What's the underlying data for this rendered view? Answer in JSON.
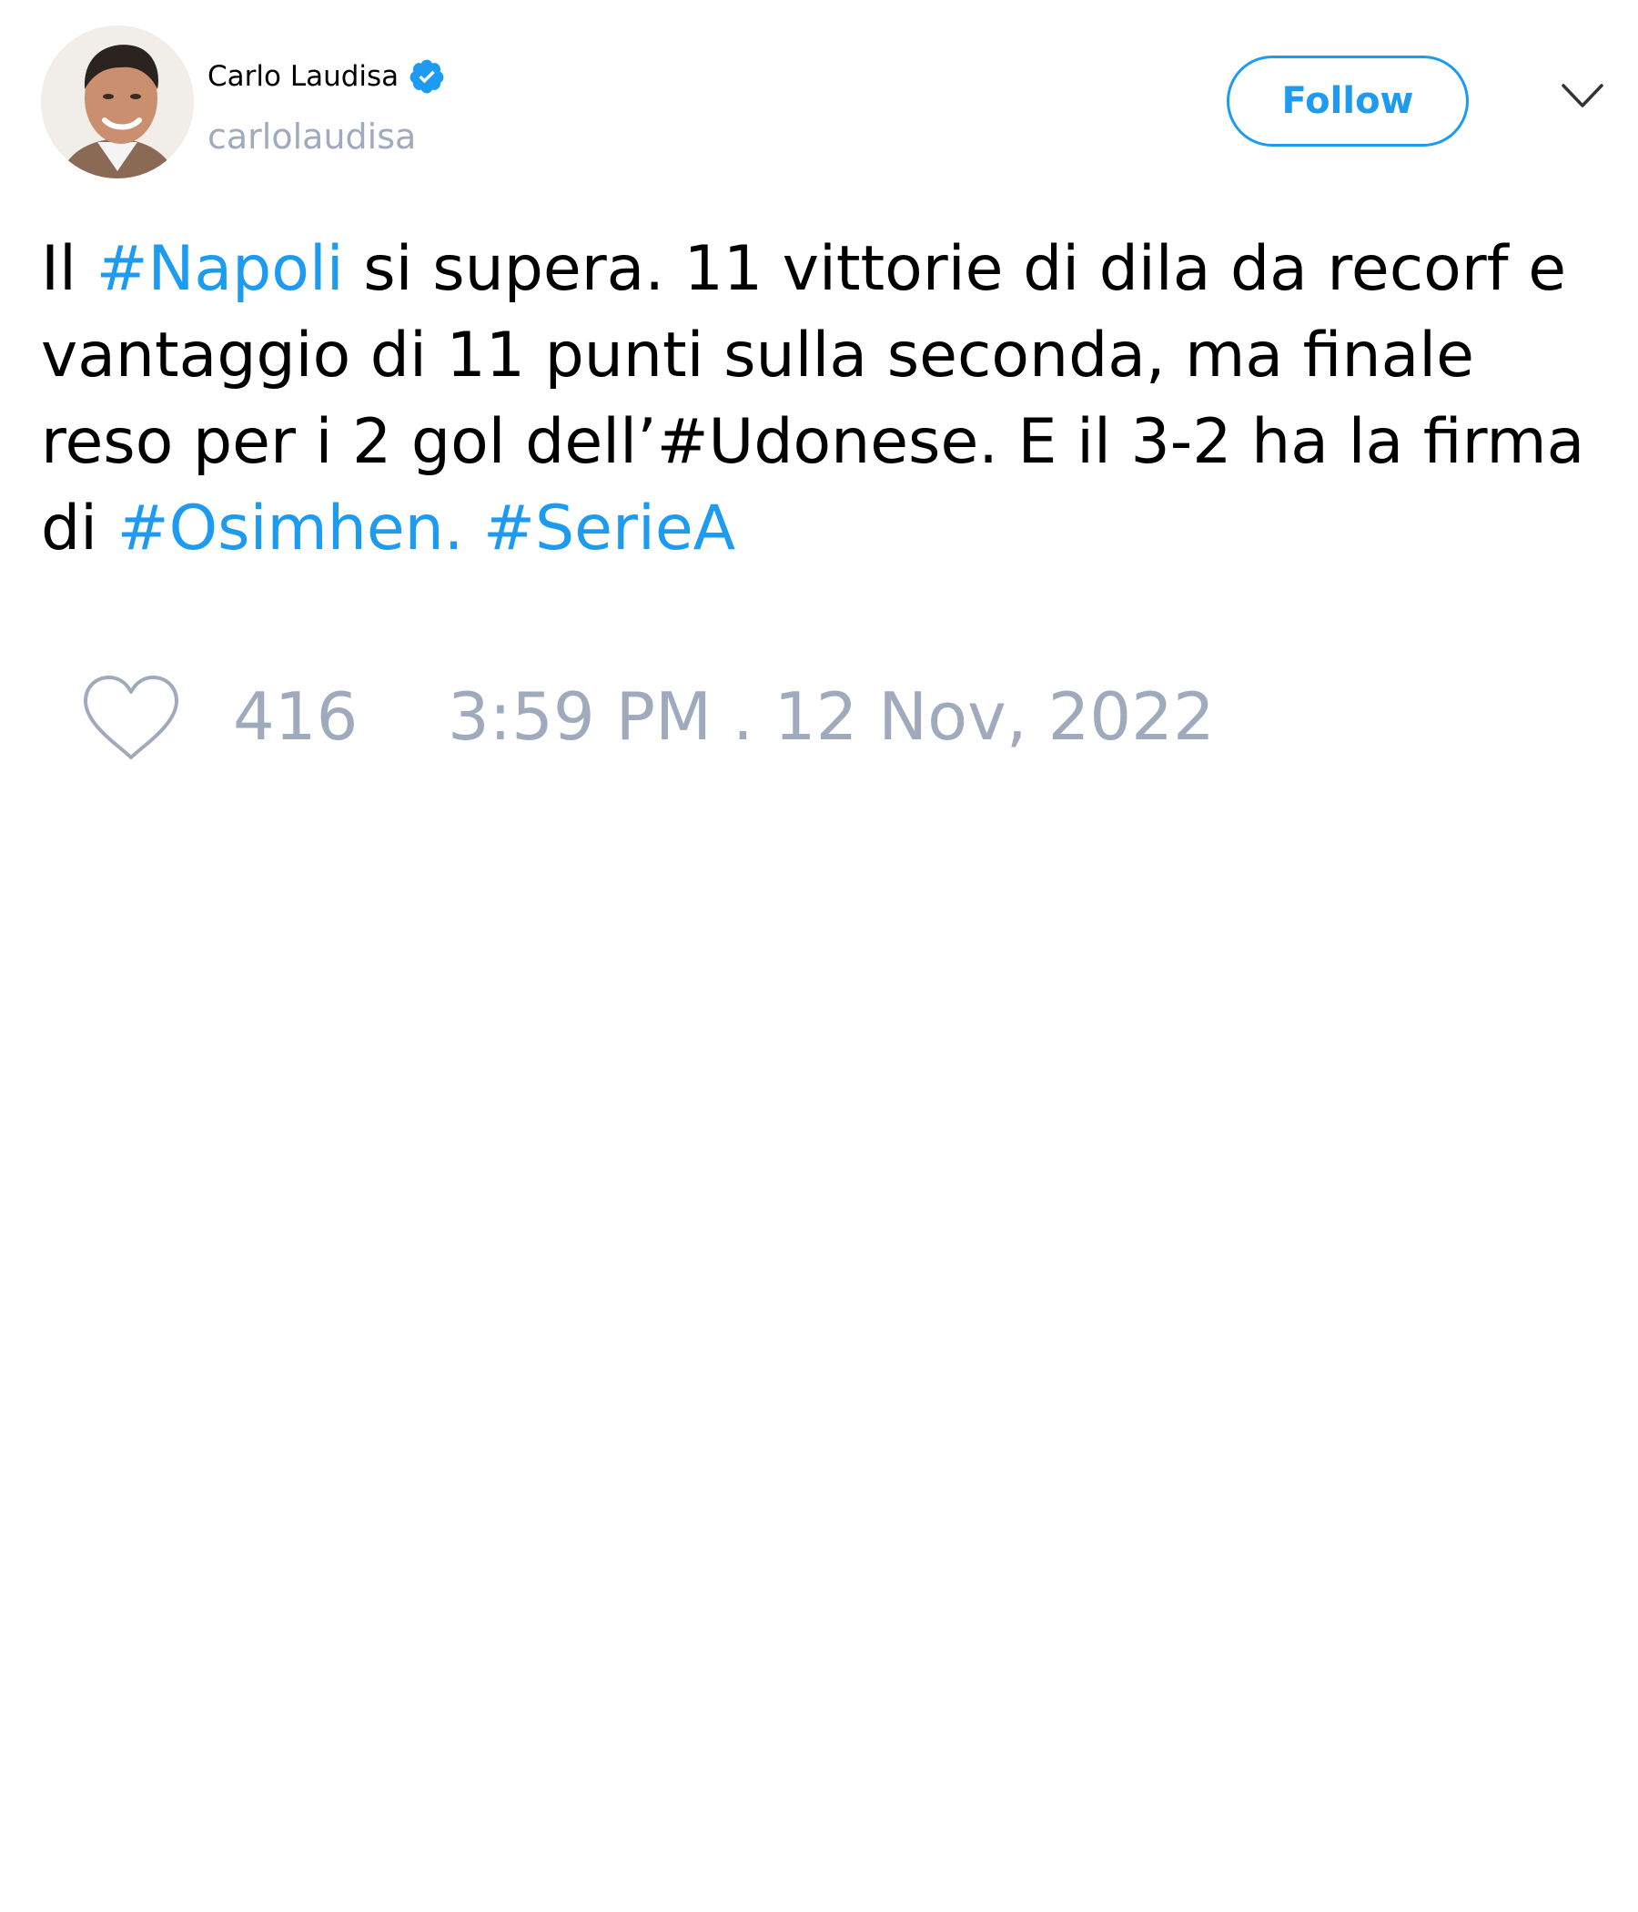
{
  "author": {
    "display_name": "Carlo Laudisa",
    "handle": "carlolaudisa",
    "verified": true
  },
  "header": {
    "follow_label": "Follow",
    "menu_icon": "chevron-down-icon"
  },
  "tweet": {
    "line1": {
      "pre": "Il ",
      "hashtag": "#Napoli",
      "post": " si supera. 11 vittorie di dila da recorf e"
    },
    "line2": "vantaggio di 11 punti sulla seconda, ma finale",
    "line3": "reso per i 2 gol dell’#Udonese. E il 3-2 ha la firma",
    "line4": {
      "pre": "di ",
      "hashtag1": "#Osimhen.",
      "hashtag2": "#SerieA"
    }
  },
  "footer": {
    "like_icon": "heart-icon",
    "like_count": "416",
    "timestamp": "3:59 PM . 12 Nov, 2022"
  },
  "colors": {
    "accent": "#1d9bf0",
    "secondary_text": "#9fabbd",
    "text": "#000000",
    "background": "#ffffff"
  }
}
